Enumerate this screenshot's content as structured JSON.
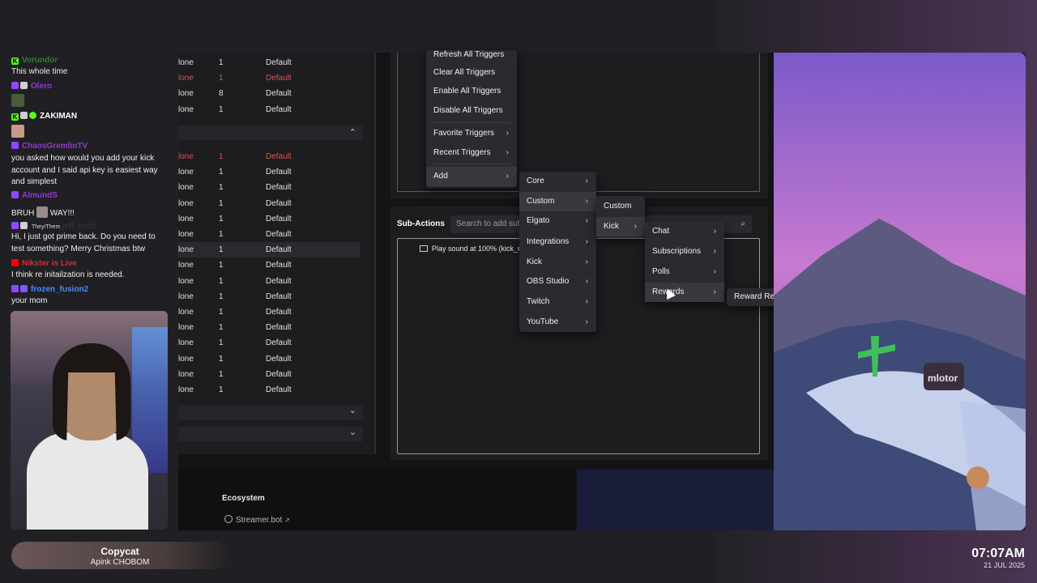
{
  "chat": {
    "messages": [
      {
        "user": "Vorundor",
        "platform": "kick",
        "user_color": "#2e7d32",
        "text": "This whole time"
      },
      {
        "user": "Olero",
        "platform": "twitch",
        "user_color": "#8f3ad1",
        "text": ""
      },
      {
        "user": "ZAKIMAN",
        "platform": "kick",
        "user_color": "#ffffff",
        "text": ""
      },
      {
        "user": "ChaosGremlinTV",
        "platform": "twitch",
        "user_color": "#8f3ad1",
        "text": "you asked how would you add your kick account and I said api key is easiest way and simplest"
      },
      {
        "user": "AlmundS",
        "platform": "twitch",
        "user_color": "#8f3ad1",
        "text_before": "BRUH",
        "text_after": "WAY!!!"
      },
      {
        "user": "jeff_rodz",
        "platform": "twitch",
        "pronouns": "They/Them",
        "user_color": "#333333",
        "text": "Hi, I just got prime back. Do you need to test something? Merry Christmas btw"
      },
      {
        "user": "Nikster is Live",
        "platform": "youtube",
        "user_color": "#d32f2f",
        "text": "I think re initailzation is needed."
      },
      {
        "user": "frozen_fusion2",
        "platform": "twitch",
        "user_color": "#4a8cff",
        "text": "your mom"
      }
    ],
    "msg_lines": {
      "chaos_line1": "you asked how would you add your kick",
      "chaos_line2": "account and I said api key is easiest way",
      "chaos_line3": "and simplest",
      "jeff_line1": "Hi, I just got prime back. Do you need to",
      "jeff_line2": "test something? Merry Christmas btw"
    }
  },
  "table": {
    "rows_top": [
      {
        "c1": "lone",
        "c2": "1",
        "c3": "Default",
        "red": false
      },
      {
        "c1": "lone",
        "c2": "1",
        "c3": "Default",
        "red": true
      },
      {
        "c1": "lone",
        "c2": "8",
        "c3": "Default",
        "red": false
      },
      {
        "c1": "lone",
        "c2": "1",
        "c3": "Default",
        "red": false
      }
    ],
    "rows_group": [
      {
        "c1": "lone",
        "c2": "1",
        "c3": "Default",
        "red": true
      },
      {
        "c1": "lone",
        "c2": "1",
        "c3": "Default",
        "red": false
      },
      {
        "c1": "lone",
        "c2": "1",
        "c3": "Default",
        "red": false
      },
      {
        "c1": "lone",
        "c2": "1",
        "c3": "Default",
        "red": false
      },
      {
        "c1": "lone",
        "c2": "1",
        "c3": "Default",
        "red": false
      },
      {
        "c1": "lone",
        "c2": "1",
        "c3": "Default",
        "red": false
      },
      {
        "c1": "lone",
        "c2": "1",
        "c3": "Default",
        "red": false,
        "selected": true
      },
      {
        "c1": "lone",
        "c2": "1",
        "c3": "Default",
        "red": false
      },
      {
        "c1": "lone",
        "c2": "1",
        "c3": "Default",
        "red": false
      },
      {
        "c1": "lone",
        "c2": "1",
        "c3": "Default",
        "red": false
      },
      {
        "c1": "lone",
        "c2": "1",
        "c3": "Default",
        "red": false
      },
      {
        "c1": "lone",
        "c2": "1",
        "c3": "Default",
        "red": false
      },
      {
        "c1": "lone",
        "c2": "1",
        "c3": "Default",
        "red": false
      },
      {
        "c1": "lone",
        "c2": "1",
        "c3": "Default",
        "red": false
      },
      {
        "c1": "lone",
        "c2": "1",
        "c3": "Default",
        "red": false
      },
      {
        "c1": "lone",
        "c2": "1",
        "c3": "Default",
        "red": false
      }
    ]
  },
  "subactions": {
    "title": "Sub-Actions",
    "search_placeholder": "Search to add sub",
    "item": "Play sound at 100% (kick_r",
    "item_tail": ")"
  },
  "menus": {
    "triggers_menu": {
      "items": [
        "Refresh All Triggers",
        "Clear All Triggers",
        "Enable All Triggers",
        "Disable All Triggers",
        "Favorite Triggers",
        "Recent Triggers",
        "Add"
      ]
    },
    "add_menu": {
      "items": [
        "Core",
        "Custom",
        "Elgato",
        "Integrations",
        "Kick",
        "OBS Studio",
        "Twitch",
        "YouTube"
      ]
    },
    "custom_menu": {
      "items": [
        "Custom",
        "Kick"
      ]
    },
    "kick_menu": {
      "items": [
        "Chat",
        "Subscriptions",
        "Polls",
        "Rewards"
      ]
    },
    "rewards_menu": {
      "items": [
        "Reward Redeemed (Any)"
      ]
    }
  },
  "ecosystem": {
    "title": "Ecosystem",
    "link": "Streamer.bot",
    "link_suffix": "↗"
  },
  "now_playing": {
    "title": "Copycat",
    "artist": "Apink CHOBOM"
  },
  "clock": {
    "time": "07:07AM",
    "date": "21 JUL 2025"
  },
  "artwork": {
    "sign_text": "mlotor"
  },
  "icons": {
    "chevron_up": "⌃",
    "chevron_down": "⌄",
    "arrow_right": "›",
    "search": "⌕"
  }
}
